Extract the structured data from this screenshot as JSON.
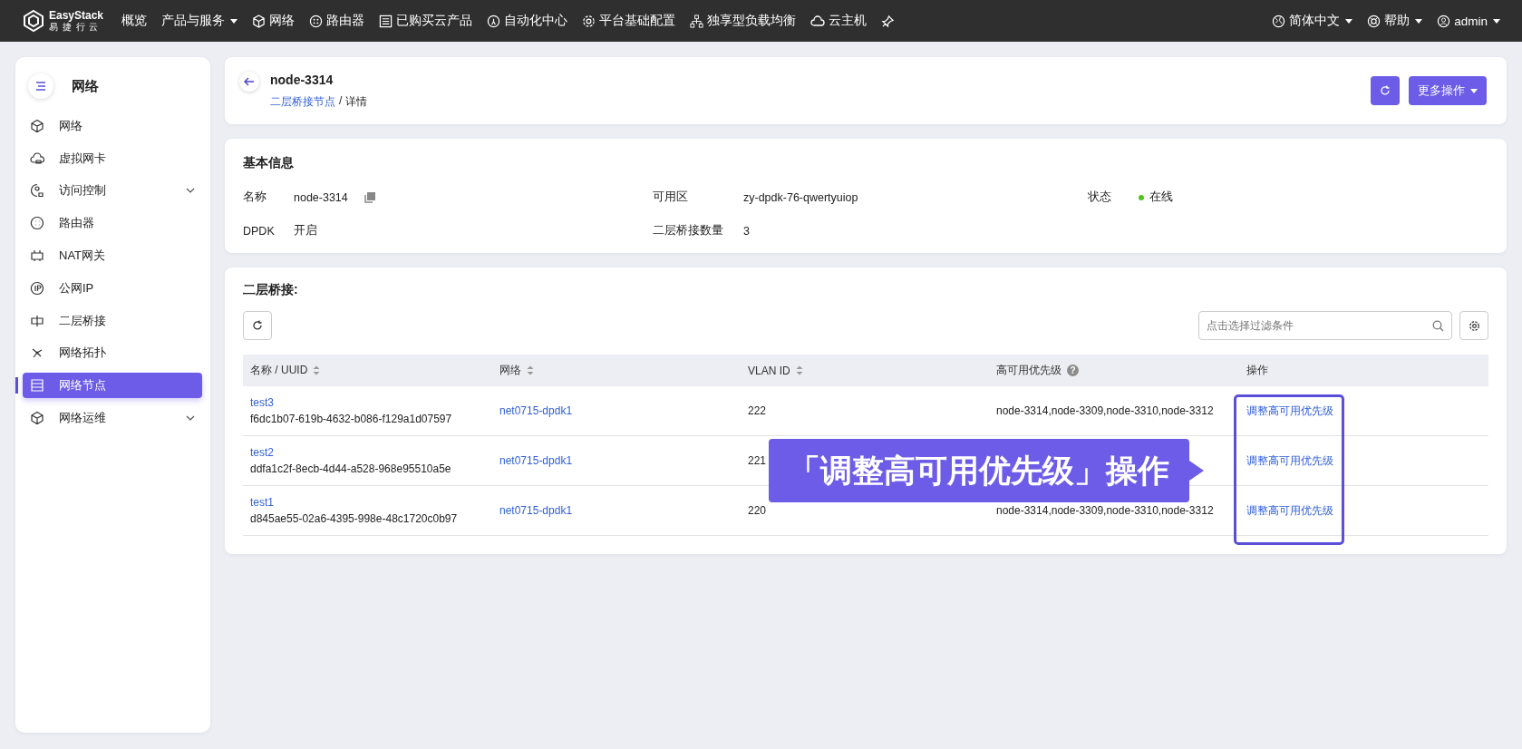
{
  "topbar": {
    "logo": {
      "name": "EasyStack",
      "subtitle": "易 捷 行 云"
    },
    "nav": [
      {
        "label": "概览",
        "kind": "plain"
      },
      {
        "label": "产品与服务",
        "kind": "dropdown"
      },
      {
        "label": "网络",
        "kind": "cube"
      },
      {
        "label": "路由器",
        "kind": "router"
      },
      {
        "label": "已购买云产品",
        "kind": "list"
      },
      {
        "label": "自动化中心",
        "kind": "auto"
      },
      {
        "label": "平台基础配置",
        "kind": "gear"
      },
      {
        "label": "独享型负载均衡",
        "kind": "tree"
      },
      {
        "label": "云主机",
        "kind": "cloud"
      },
      {
        "kind": "pin"
      }
    ],
    "right": [
      {
        "label": "简体中文",
        "kind": "globe"
      },
      {
        "label": "帮助",
        "kind": "help"
      },
      {
        "label": "admin",
        "kind": "user"
      }
    ]
  },
  "sidebar": {
    "title": "网络",
    "items": [
      {
        "label": "网络",
        "kind": "cube",
        "selected": false,
        "expandable": false
      },
      {
        "label": "虚拟网卡",
        "kind": "cloud",
        "selected": false,
        "expandable": false
      },
      {
        "label": "访问控制",
        "kind": "lock",
        "selected": false,
        "expandable": true
      },
      {
        "label": "路由器",
        "kind": "router",
        "selected": false,
        "expandable": false
      },
      {
        "label": "NAT网关",
        "kind": "gateway",
        "selected": false,
        "expandable": false
      },
      {
        "label": "公网IP",
        "kind": "ip",
        "selected": false,
        "expandable": false
      },
      {
        "label": "二层桥接",
        "kind": "bridge",
        "selected": false,
        "expandable": false
      },
      {
        "label": "网络拓扑",
        "kind": "topo",
        "selected": false,
        "expandable": false
      },
      {
        "label": "网络节点",
        "kind": "server",
        "selected": true,
        "expandable": false
      },
      {
        "label": "网络运维",
        "kind": "cube",
        "selected": false,
        "expandable": true
      }
    ]
  },
  "header": {
    "title": "node-3314",
    "breadcrumb": {
      "link": "二层桥接节点",
      "separator": "/",
      "current": "详情"
    },
    "more_button": "更多操作"
  },
  "basic_info": {
    "title": "基本信息",
    "fields": [
      {
        "label": "名称",
        "value": "node-3314",
        "kind": "copy"
      },
      {
        "label": "可用区",
        "value": "zy-dpdk-76-qwertyuiop",
        "kind": "text"
      },
      {
        "label": "状态",
        "value": "在线",
        "kind": "status",
        "color": "#52c41a"
      },
      {
        "label": "DPDK",
        "value": "开启",
        "kind": "text"
      },
      {
        "label": "二层桥接数量",
        "value": "3",
        "kind": "text"
      }
    ]
  },
  "bridges": {
    "title": "二层桥接:",
    "filter_placeholder": "点击选择过滤条件",
    "columns": [
      {
        "label": "名称 / UUID",
        "sortable": true
      },
      {
        "label": "网络",
        "sortable": true
      },
      {
        "label": "VLAN ID",
        "sortable": true
      },
      {
        "label": "高可用优先级",
        "sortable": false,
        "help": "?"
      },
      {
        "label": "操作",
        "sortable": false
      }
    ],
    "rows": [
      {
        "name": "test3",
        "uuid": "f6dc1b07-619b-4632-b086-f129a1d07597",
        "network": "net0715-dpdk1",
        "vlan": "222",
        "priority": "node-3314,node-3309,node-3310,node-3312",
        "action": "调整高可用优先级"
      },
      {
        "name": "test2",
        "uuid": "ddfa1c2f-8ecb-4d44-a528-968e95510a5e",
        "network": "net0715-dpdk1",
        "vlan": "221",
        "action": "调整高可用优先级"
      },
      {
        "name": "test1",
        "uuid": "d845ae55-02a6-4395-998e-48c1720c0b97",
        "network": "net0715-dpdk1",
        "vlan": "220",
        "priority": "node-3314,node-3309,node-3310,node-3312",
        "action": "调整高可用优先级"
      }
    ]
  },
  "callout": {
    "text": "「调整高可用优先级」操作"
  }
}
